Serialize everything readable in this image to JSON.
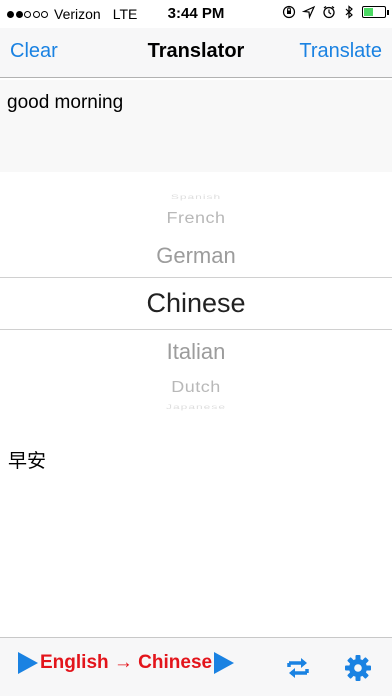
{
  "status_bar": {
    "carrier": "Verizon",
    "network": "LTE",
    "time": "3:44 PM",
    "signal_bars_filled": 2,
    "signal_bars_total": 5,
    "battery_level": 0.45
  },
  "nav": {
    "left_label": "Clear",
    "title": "Translator",
    "right_label": "Translate"
  },
  "input": {
    "value": "good morning",
    "placeholder": ""
  },
  "picker": {
    "options": [
      "Spanish",
      "French",
      "German",
      "Chinese",
      "Italian",
      "Dutch",
      "Japanese"
    ],
    "selected": "Chinese"
  },
  "output": {
    "text": "早安"
  },
  "toolbar": {
    "language_pair": "English → Chinese",
    "swap_icon": "swap-arrows-icon",
    "settings_icon": "gear-icon"
  },
  "colors": {
    "accent": "#1a82e2",
    "language_pair": "#e3141b",
    "battery": "#4cd964"
  }
}
